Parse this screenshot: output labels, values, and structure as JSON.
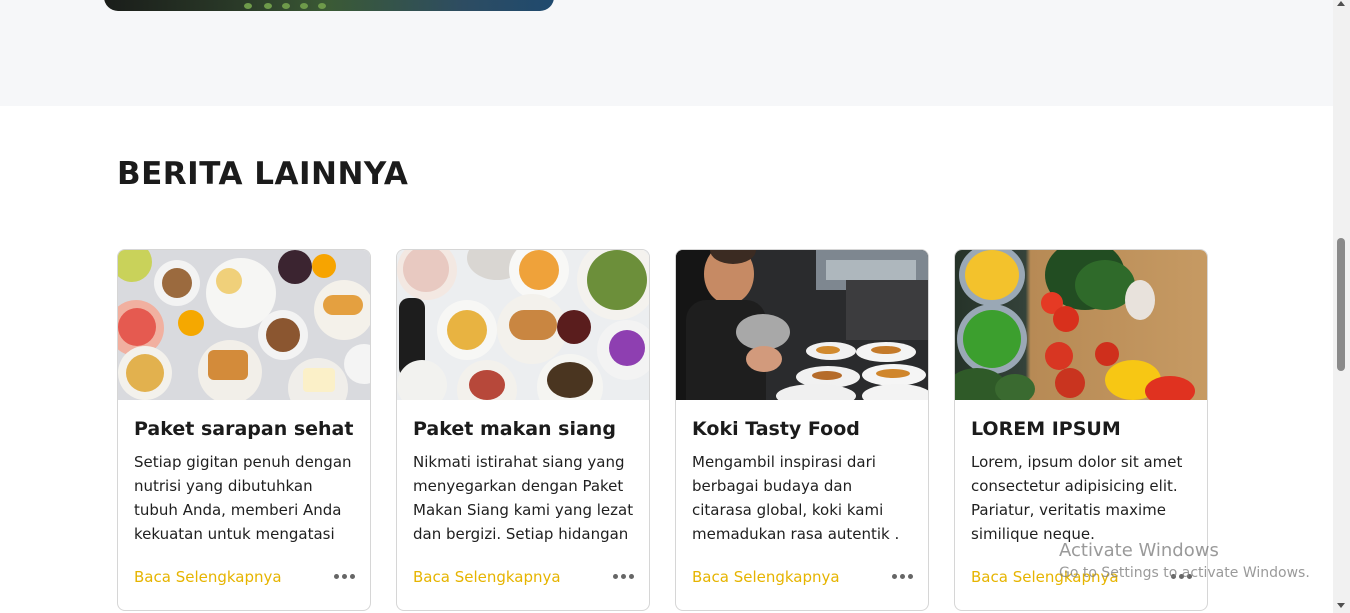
{
  "section": {
    "title": "BERITA LAINNYA"
  },
  "cards": [
    {
      "title": "Paket sarapan sehat",
      "text": "Setiap gigitan penuh dengan nutrisi yang dibutuhkan tubuh Anda, memberi Anda kekuatan untuk mengatasi",
      "link": "Baca Selengkapnya"
    },
    {
      "title": "Paket makan siang",
      "text": "Nikmati istirahat siang yang menyegarkan dengan Paket Makan Siang kami yang lezat dan bergizi. Setiap hidangan",
      "link": "Baca Selengkapnya"
    },
    {
      "title": "Koki Tasty Food",
      "text": "Mengambil inspirasi dari berbagai budaya dan citarasa global, koki kami memadukan rasa autentik .",
      "link": "Baca Selengkapnya"
    },
    {
      "title": "LOREM IPSUM",
      "text": "Lorem, ipsum dolor sit amet consectetur adipisicing elit. Pariatur, veritatis maxime similique neque.",
      "link": "Baca Selengkapnya"
    }
  ],
  "watermark": {
    "line1": "Activate Windows",
    "line2": "Go to Settings to activate Windows."
  },
  "colors": {
    "accent_link": "#e6b400",
    "top_band": "#f6f7f9"
  }
}
